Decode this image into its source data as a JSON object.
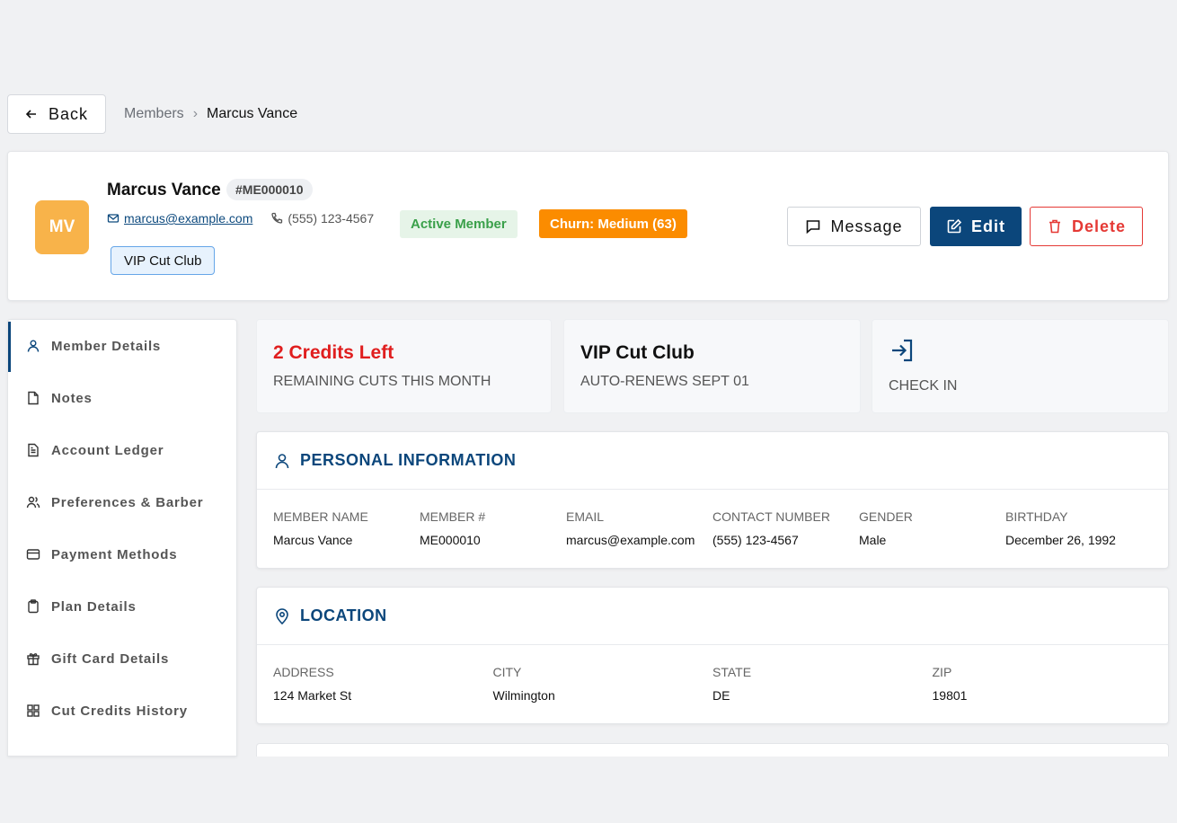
{
  "topbar": {
    "back_label": "Back",
    "breadcrumb": {
      "parent": "Members",
      "separator": "›",
      "current": "Marcus Vance"
    }
  },
  "member": {
    "initials": "MV",
    "name": "Marcus Vance",
    "id_badge": "#ME000010",
    "email": "marcus@example.com",
    "phone": "(555) 123-4567",
    "status_badge": "Active Member",
    "churn_badge": "Churn: Medium (63)",
    "plan_tag": "VIP Cut Club"
  },
  "actions": {
    "message": "Message",
    "edit": "Edit",
    "delete": "Delete"
  },
  "sidebar": {
    "items": [
      {
        "label": "Member Details",
        "icon": "user-icon",
        "active": true
      },
      {
        "label": "Notes",
        "icon": "note-icon"
      },
      {
        "label": "Account Ledger",
        "icon": "document-icon"
      },
      {
        "label": "Preferences & Barber",
        "icon": "users-icon"
      },
      {
        "label": "Payment Methods",
        "icon": "credit-card-icon"
      },
      {
        "label": "Plan Details",
        "icon": "clipboard-icon"
      },
      {
        "label": "Gift Card Details",
        "icon": "gift-icon"
      },
      {
        "label": "Cut Credits History",
        "icon": "grid-icon"
      }
    ]
  },
  "stats": {
    "credits": {
      "title": "2 Credits Left",
      "sub": "REMAINING CUTS THIS MONTH"
    },
    "plan": {
      "title": "VIP Cut Club",
      "sub": "AUTO-RENEWS SEPT 01"
    },
    "checkin": {
      "sub": "CHECK IN",
      "icon": "sign-in-icon"
    }
  },
  "personal": {
    "title": "PERSONAL INFORMATION",
    "fields": [
      {
        "label": "MEMBER NAME",
        "value": "Marcus Vance"
      },
      {
        "label": "MEMBER #",
        "value": "ME000010"
      },
      {
        "label": "EMAIL",
        "value": "marcus@example.com"
      },
      {
        "label": "CONTACT NUMBER",
        "value": "(555) 123-4567"
      },
      {
        "label": "GENDER",
        "value": "Male"
      },
      {
        "label": "BIRTHDAY",
        "value": "December 26, 1992"
      }
    ]
  },
  "location": {
    "title": "LOCATION",
    "fields": [
      {
        "label": "ADDRESS",
        "value": "124 Market St"
      },
      {
        "label": "CITY",
        "value": "Wilmington"
      },
      {
        "label": "STATE",
        "value": "DE"
      },
      {
        "label": "ZIP",
        "value": "19801"
      }
    ]
  },
  "colors": {
    "primary": "#0b467b",
    "danger": "#e53935",
    "warning": "#fb8c00",
    "success": "#3aa04a",
    "avatar": "#f8b34a"
  }
}
